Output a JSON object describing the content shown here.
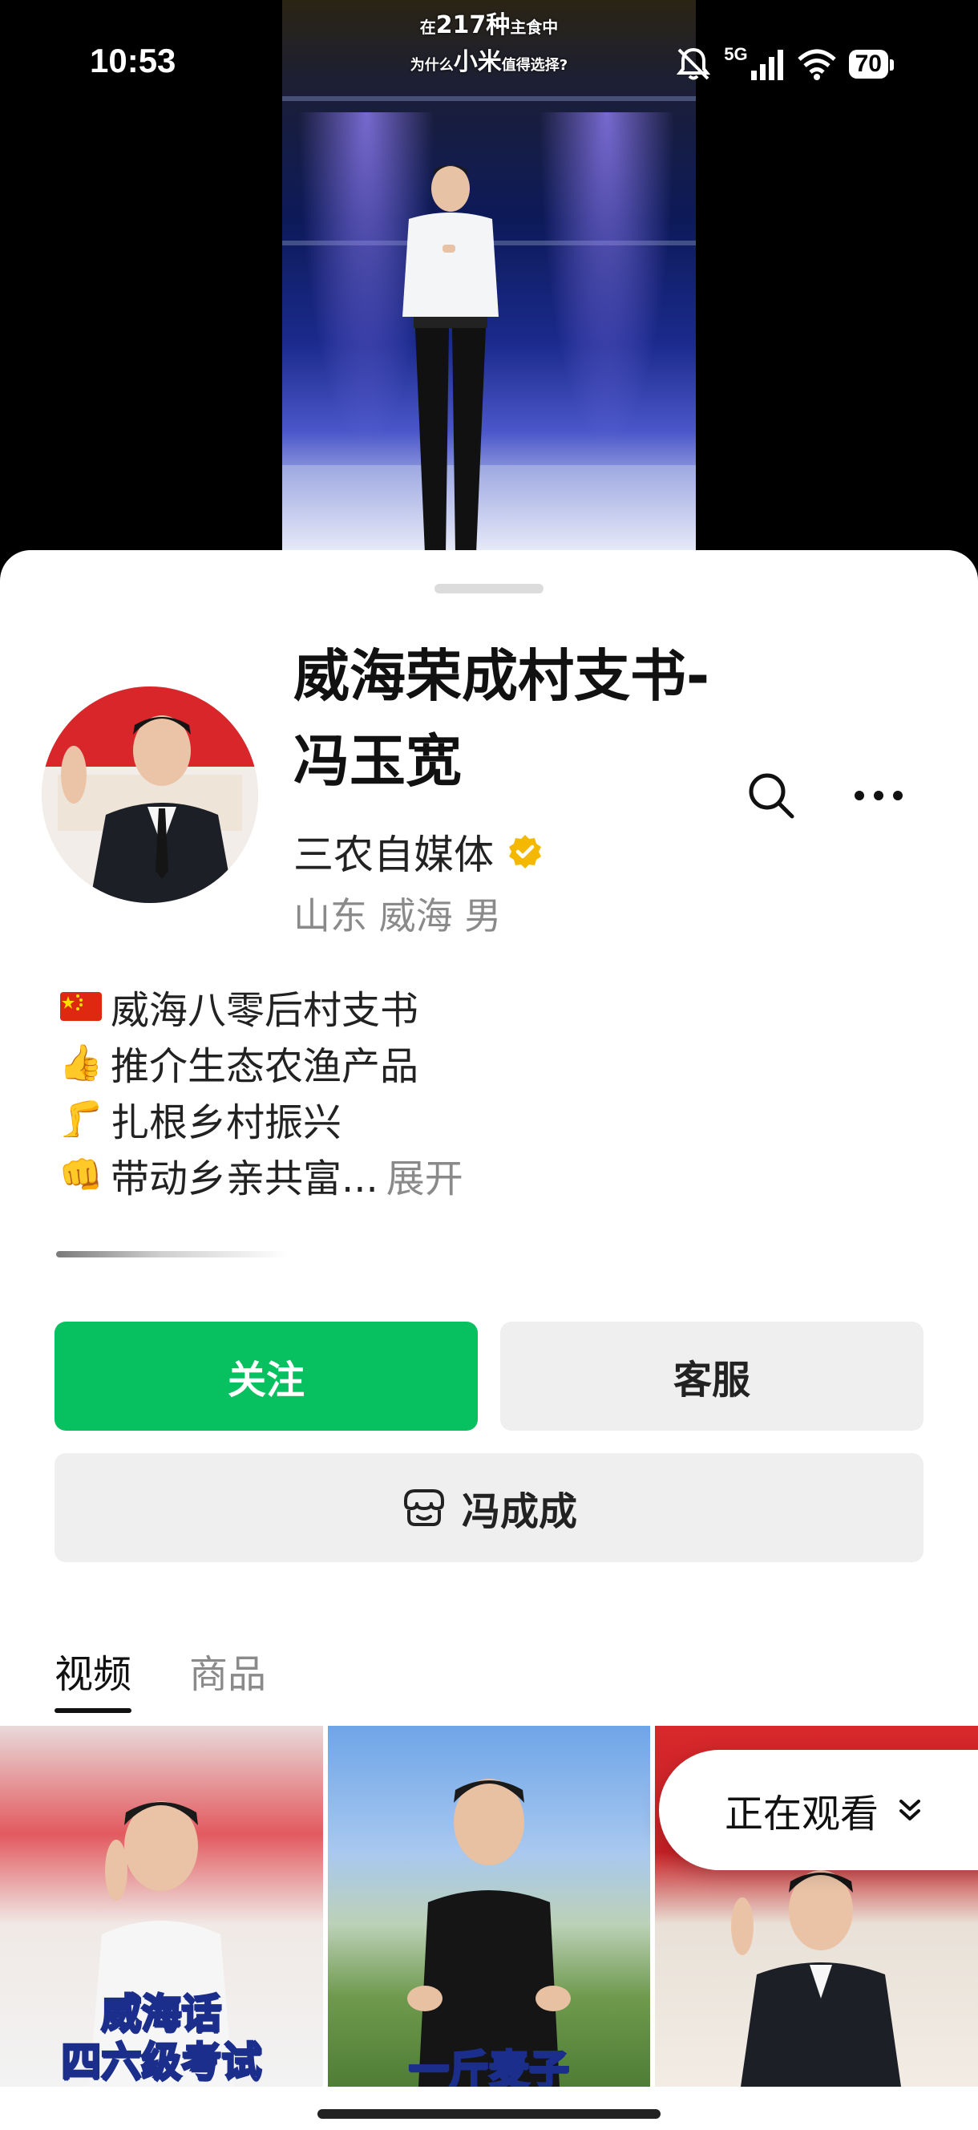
{
  "status_bar": {
    "time": "10:53",
    "network": "5G",
    "battery": "70",
    "icons": [
      "mute-bell-icon",
      "signal-icon",
      "wifi-icon",
      "battery-icon"
    ]
  },
  "video": {
    "caption_line1_pre": "在",
    "caption_line1_num": "217种",
    "caption_line1_post": "主食中",
    "caption_line2_pre": "为什么",
    "caption_line2_big": "小米",
    "caption_line2_post": "值得选择?"
  },
  "profile": {
    "name": "威海荣成村支书-冯玉宽",
    "category": "三农自媒体",
    "verified_icon": "verified-badge-icon",
    "location": "山东 威海 男",
    "bio": [
      {
        "emoji": "🇨🇳",
        "text": "威海八零后村支书"
      },
      {
        "emoji": "👍",
        "text": "推介生态农渔产品"
      },
      {
        "emoji": "🦵",
        "text": "扎根乡村振兴"
      },
      {
        "emoji": "👊",
        "text": "带动乡亲共富..."
      }
    ],
    "expand_label": "展开"
  },
  "actions": {
    "follow_label": "关注",
    "service_label": "客服",
    "store_label": "冯成成"
  },
  "tabs": [
    {
      "label": "视频",
      "active": true
    },
    {
      "label": "商品",
      "active": false
    }
  ],
  "videos": [
    {
      "caption_line1": "威海话",
      "caption_line2": "四六级考试"
    },
    {
      "caption_line1": "一斤麦子"
    },
    {
      "caption_line1": ""
    }
  ],
  "now_watching": {
    "label": "正在观看"
  },
  "colors": {
    "accent_green": "#07c160",
    "verified_gold": "#f5b800"
  }
}
